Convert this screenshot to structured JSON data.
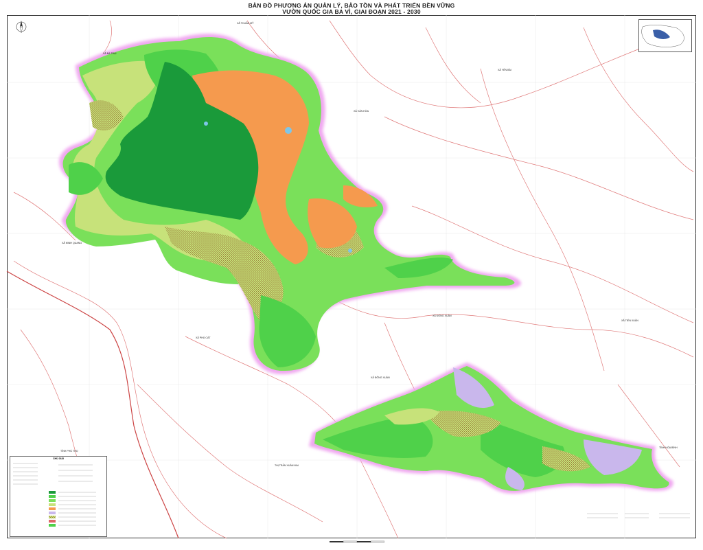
{
  "map": {
    "title_line1": "BẢN ĐỒ PHƯƠNG ÁN QUẢN LÝ, BẢO TỒN VÀ PHÁT TRIỂN BỀN VỮNG",
    "title_line2": "VƯỜN QUỐC GIA BA VÌ, GIAI ĐOẠN 2021 - 2030",
    "legend_title": "CHÚ GIẢI",
    "colors": {
      "dark_forest": "#1a9a3a",
      "forest_green": "#4fd14a",
      "light_green": "#7ae05a",
      "yellow_green": "#c7e27a",
      "orange": "#f59a4e",
      "lavender": "#c9b7ec",
      "hatch": "#b5a24a",
      "boundary_glow": "#f0a8f0",
      "road_red": "#e06666",
      "water": "#7fc6e8"
    },
    "places": [
      {
        "id": "p1",
        "text": "XÃ BA TRẠI"
      },
      {
        "id": "p2",
        "text": "XÃ THUẦN MỸ"
      },
      {
        "id": "p3",
        "text": "XÃ MINH QUANG"
      },
      {
        "id": "p4",
        "text": "XÃ VÂN HÒA"
      },
      {
        "id": "p5",
        "text": "XÃ YÊN BÀI"
      },
      {
        "id": "p6",
        "text": "XÃ ĐỒNG XUÂN"
      },
      {
        "id": "p7",
        "text": "XÃ TIẾN XUÂN"
      },
      {
        "id": "p8",
        "text": "XÃ PHÚ CÁT"
      },
      {
        "id": "p9",
        "text": "XÃ ĐÔNG XUÂN"
      },
      {
        "id": "p10",
        "text": "THỊ TRẤN XUÂN MAI"
      },
      {
        "id": "p11",
        "text": "TỈNH PHÚ THỌ"
      },
      {
        "id": "p12",
        "text": "TỈNH HÒA BÌNH"
      }
    ]
  }
}
